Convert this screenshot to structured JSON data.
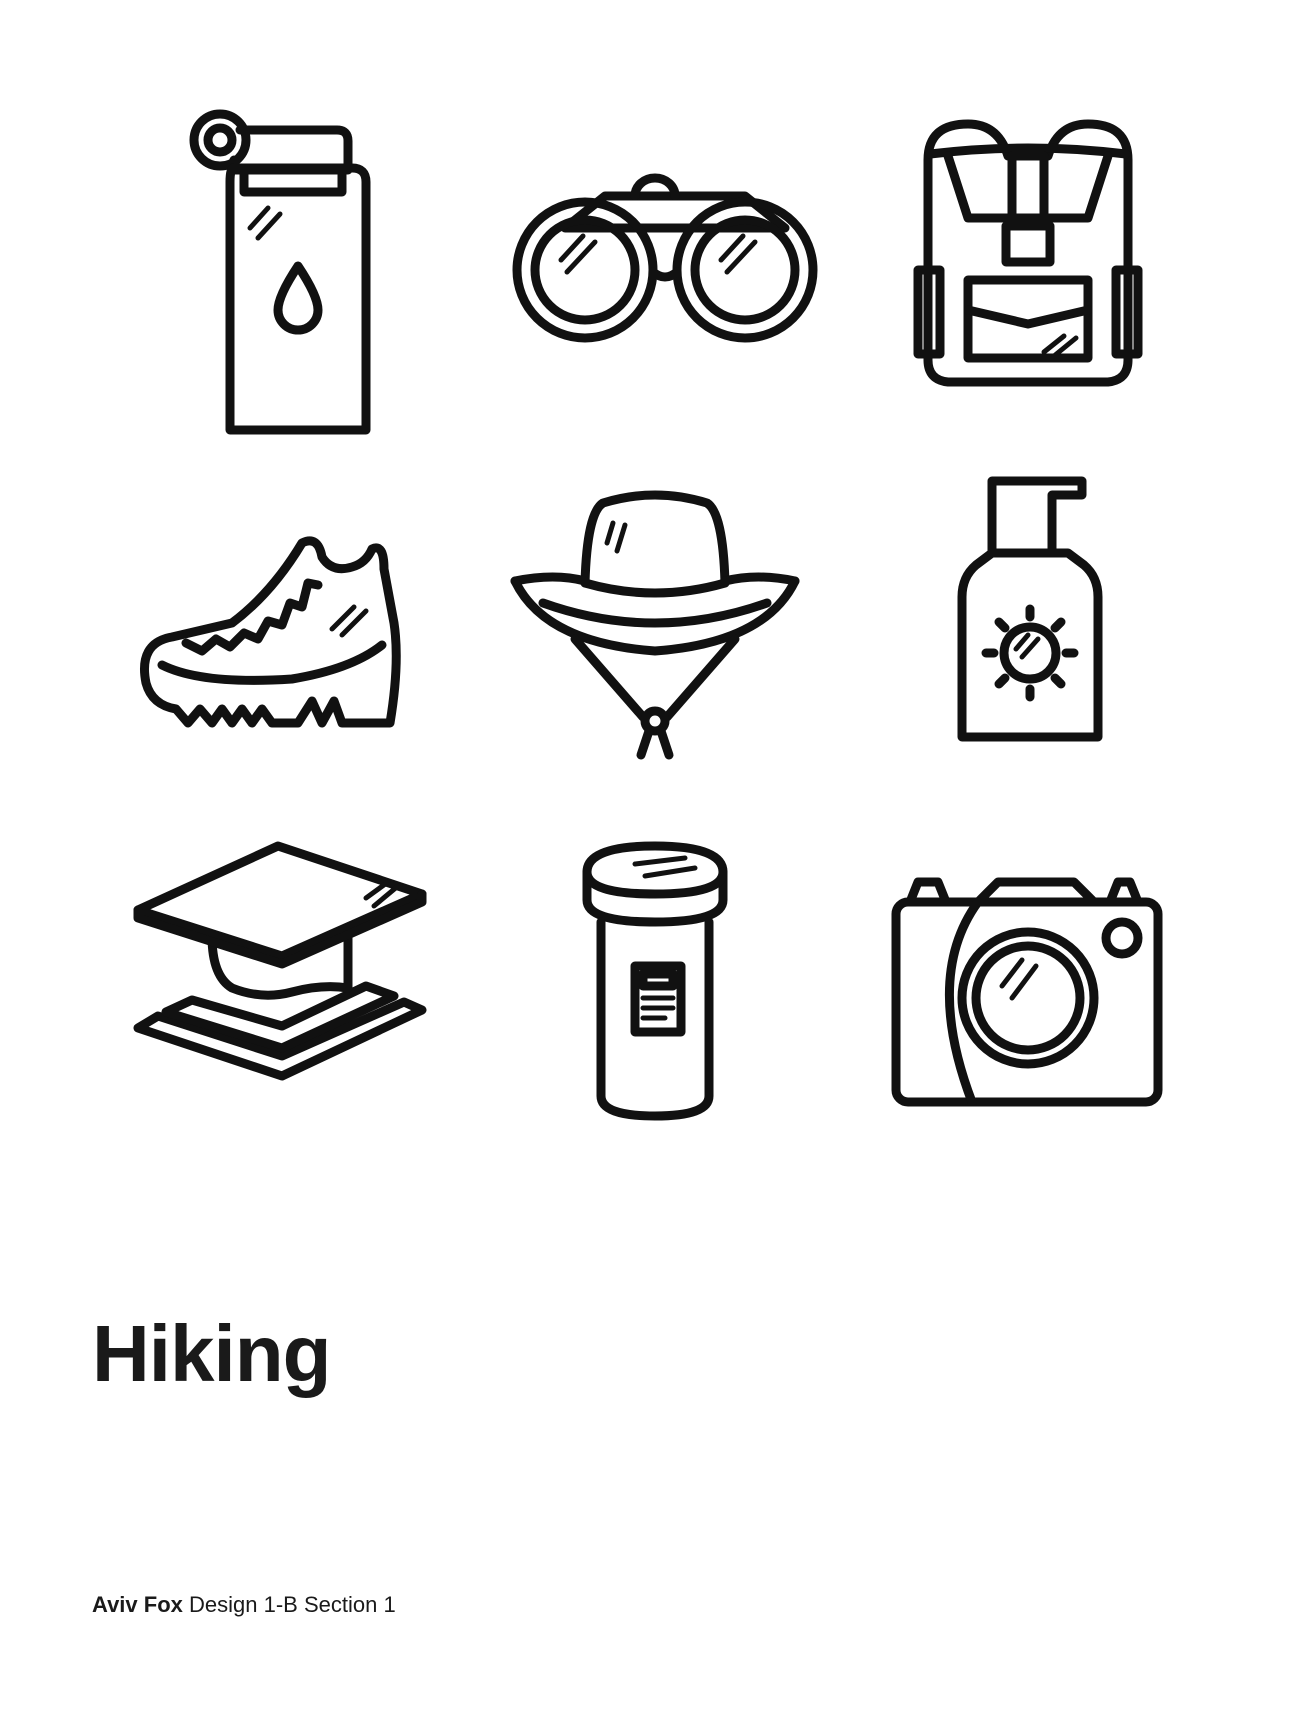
{
  "title": "Hiking",
  "credit": {
    "author": "Aviv Fox",
    "detail": "Design 1-B Section 1"
  },
  "icons": [
    {
      "name": "water-bottle-icon"
    },
    {
      "name": "binoculars-icon"
    },
    {
      "name": "backpack-icon"
    },
    {
      "name": "hiking-boot-icon"
    },
    {
      "name": "bucket-hat-icon"
    },
    {
      "name": "sunscreen-bottle-icon"
    },
    {
      "name": "map-icon"
    },
    {
      "name": "flashlight-icon"
    },
    {
      "name": "camera-icon"
    }
  ]
}
